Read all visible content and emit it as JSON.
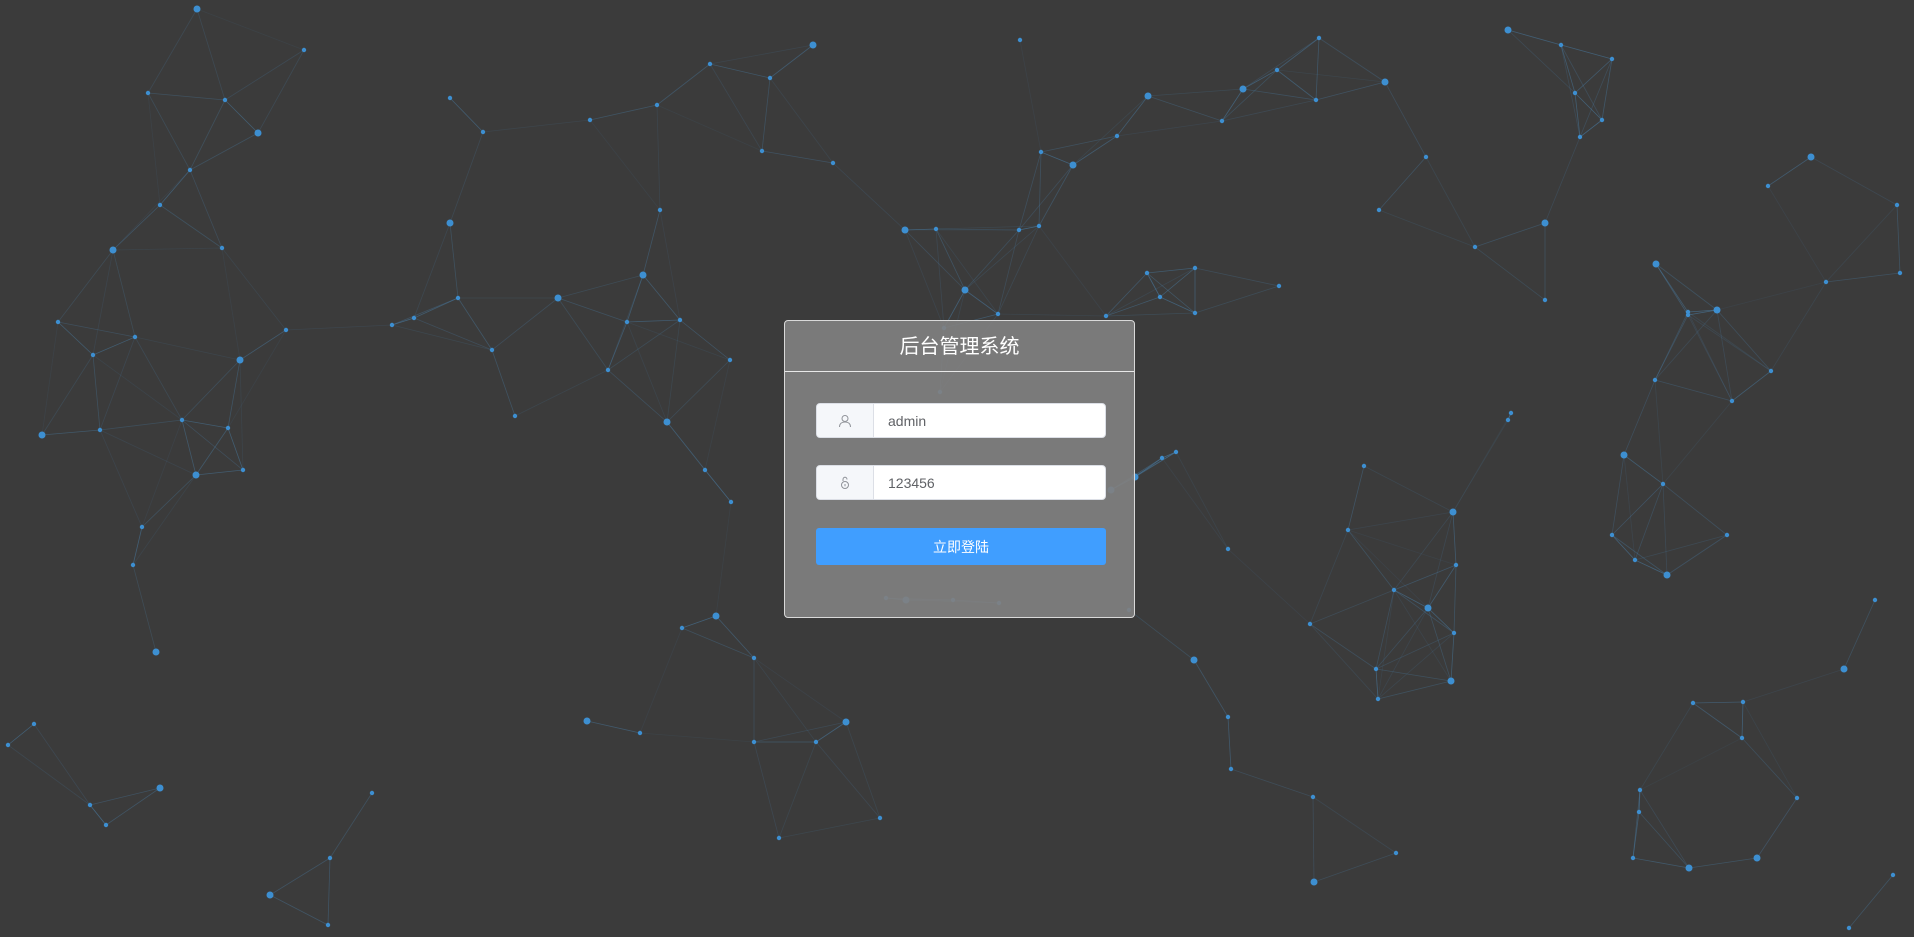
{
  "app": {
    "title": "后台管理系统"
  },
  "login": {
    "username_value": "admin",
    "username_icon": "user-icon",
    "password_value": "123456",
    "password_icon": "lock-icon",
    "submit_label": "立即登陆"
  },
  "colors": {
    "background": "#3b3b3b",
    "network_node": "#3d8fd1",
    "network_line": "#4a7fa8",
    "accent": "#409eff",
    "panel": "#808080"
  },
  "background": {
    "decoration": "particle-network"
  }
}
